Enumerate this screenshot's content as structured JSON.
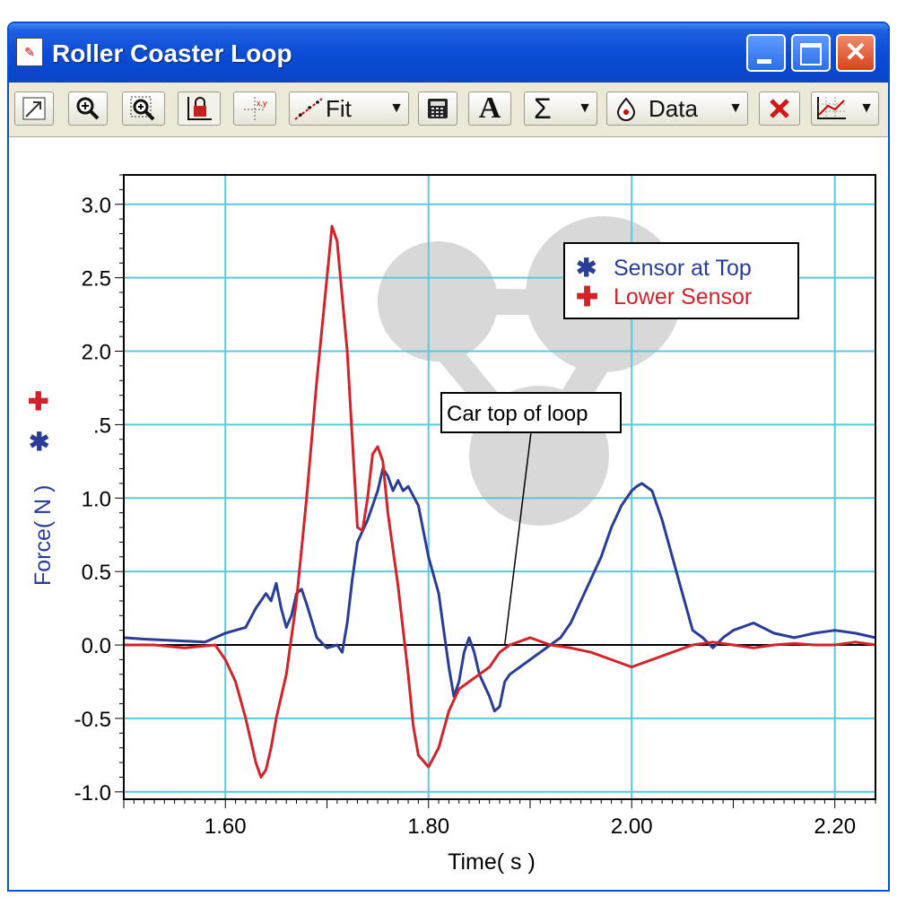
{
  "window": {
    "title": "Roller Coaster Loop",
    "controls": {
      "minimize_icon": "minimize-icon",
      "maximize_icon": "maximize-icon",
      "close_symbol": "✕"
    }
  },
  "toolbar": {
    "buttons": [
      {
        "name": "autoscale-icon"
      },
      {
        "name": "zoom-in-icon"
      },
      {
        "name": "zoom-region-icon"
      },
      {
        "name": "lock-axes-icon"
      },
      {
        "name": "examine-icon"
      },
      {
        "name": "fit",
        "label": "Fit",
        "dropdown": true
      },
      {
        "name": "calculator-icon"
      },
      {
        "name": "annotate",
        "label": "A"
      },
      {
        "name": "statistics",
        "label": "Σ",
        "dropdown": true
      },
      {
        "name": "data",
        "label": "Data",
        "dropdown": true
      },
      {
        "name": "delete-icon"
      },
      {
        "name": "graph-options-icon",
        "dropdown": true
      }
    ]
  },
  "chart_data": {
    "type": "line",
    "xlabel": "Time( s )",
    "ylabel": "Force( N )",
    "xlim": [
      1.5,
      2.24
    ],
    "ylim": [
      -1.05,
      3.2
    ],
    "x_ticks": [
      1.6,
      1.8,
      2.0,
      2.2
    ],
    "x_tick_labels": [
      "1.60",
      "1.80",
      "2.00",
      "2.20"
    ],
    "y_ticks": [
      3.0,
      2.5,
      2.0,
      1.5,
      1.0,
      0.5,
      0.0,
      -0.5,
      -1.0
    ],
    "y_tick_labels": [
      "3.0",
      "2.5",
      "2.0",
      ".5",
      "1.0",
      "0.5",
      "0.0",
      "-0.5",
      "-1.0"
    ],
    "grid": true,
    "legend_position": "top-right",
    "annotation": {
      "text": "Car top of loop",
      "x": 1.875,
      "y": 0.0
    },
    "series": [
      {
        "name": "Sensor at Top",
        "color": "#2a3d96",
        "marker": "asterisk",
        "points": [
          [
            1.5,
            0.05
          ],
          [
            1.52,
            0.04
          ],
          [
            1.55,
            0.03
          ],
          [
            1.58,
            0.02
          ],
          [
            1.6,
            0.08
          ],
          [
            1.62,
            0.12
          ],
          [
            1.63,
            0.25
          ],
          [
            1.64,
            0.35
          ],
          [
            1.645,
            0.3
          ],
          [
            1.65,
            0.42
          ],
          [
            1.655,
            0.25
          ],
          [
            1.66,
            0.12
          ],
          [
            1.665,
            0.2
          ],
          [
            1.67,
            0.35
          ],
          [
            1.675,
            0.38
          ],
          [
            1.68,
            0.28
          ],
          [
            1.69,
            0.05
          ],
          [
            1.7,
            -0.02
          ],
          [
            1.71,
            0.0
          ],
          [
            1.715,
            -0.05
          ],
          [
            1.72,
            0.15
          ],
          [
            1.725,
            0.45
          ],
          [
            1.73,
            0.7
          ],
          [
            1.74,
            0.85
          ],
          [
            1.75,
            1.05
          ],
          [
            1.755,
            1.2
          ],
          [
            1.76,
            1.15
          ],
          [
            1.765,
            1.05
          ],
          [
            1.77,
            1.12
          ],
          [
            1.775,
            1.05
          ],
          [
            1.78,
            1.08
          ],
          [
            1.79,
            0.95
          ],
          [
            1.8,
            0.6
          ],
          [
            1.81,
            0.35
          ],
          [
            1.815,
            0.1
          ],
          [
            1.82,
            -0.15
          ],
          [
            1.825,
            -0.35
          ],
          [
            1.83,
            -0.25
          ],
          [
            1.835,
            -0.05
          ],
          [
            1.84,
            0.05
          ],
          [
            1.845,
            -0.05
          ],
          [
            1.85,
            -0.2
          ],
          [
            1.86,
            -0.35
          ],
          [
            1.865,
            -0.45
          ],
          [
            1.87,
            -0.42
          ],
          [
            1.875,
            -0.25
          ],
          [
            1.88,
            -0.2
          ],
          [
            1.89,
            -0.15
          ],
          [
            1.9,
            -0.1
          ],
          [
            1.91,
            -0.05
          ],
          [
            1.92,
            0.0
          ],
          [
            1.93,
            0.05
          ],
          [
            1.94,
            0.15
          ],
          [
            1.95,
            0.3
          ],
          [
            1.96,
            0.45
          ],
          [
            1.97,
            0.6
          ],
          [
            1.98,
            0.8
          ],
          [
            1.99,
            0.95
          ],
          [
            2.0,
            1.05
          ],
          [
            2.005,
            1.08
          ],
          [
            2.01,
            1.1
          ],
          [
            2.02,
            1.05
          ],
          [
            2.03,
            0.85
          ],
          [
            2.04,
            0.6
          ],
          [
            2.05,
            0.35
          ],
          [
            2.06,
            0.1
          ],
          [
            2.07,
            0.05
          ],
          [
            2.08,
            -0.02
          ],
          [
            2.09,
            0.05
          ],
          [
            2.1,
            0.1
          ],
          [
            2.12,
            0.15
          ],
          [
            2.14,
            0.08
          ],
          [
            2.16,
            0.05
          ],
          [
            2.18,
            0.08
          ],
          [
            2.2,
            0.1
          ],
          [
            2.22,
            0.08
          ],
          [
            2.24,
            0.05
          ]
        ]
      },
      {
        "name": "Lower Sensor",
        "color": "#d4222a",
        "marker": "plus",
        "points": [
          [
            1.5,
            0.0
          ],
          [
            1.53,
            0.0
          ],
          [
            1.56,
            -0.02
          ],
          [
            1.59,
            0.0
          ],
          [
            1.6,
            -0.1
          ],
          [
            1.61,
            -0.25
          ],
          [
            1.62,
            -0.5
          ],
          [
            1.63,
            -0.8
          ],
          [
            1.635,
            -0.9
          ],
          [
            1.64,
            -0.85
          ],
          [
            1.645,
            -0.7
          ],
          [
            1.65,
            -0.5
          ],
          [
            1.66,
            -0.2
          ],
          [
            1.67,
            0.3
          ],
          [
            1.68,
            1.0
          ],
          [
            1.69,
            1.8
          ],
          [
            1.7,
            2.5
          ],
          [
            1.705,
            2.85
          ],
          [
            1.71,
            2.75
          ],
          [
            1.72,
            2.0
          ],
          [
            1.725,
            1.4
          ],
          [
            1.73,
            0.8
          ],
          [
            1.735,
            0.78
          ],
          [
            1.74,
            1.0
          ],
          [
            1.745,
            1.3
          ],
          [
            1.75,
            1.35
          ],
          [
            1.755,
            1.25
          ],
          [
            1.76,
            0.9
          ],
          [
            1.77,
            0.4
          ],
          [
            1.78,
            -0.2
          ],
          [
            1.785,
            -0.55
          ],
          [
            1.79,
            -0.75
          ],
          [
            1.8,
            -0.83
          ],
          [
            1.81,
            -0.7
          ],
          [
            1.82,
            -0.45
          ],
          [
            1.83,
            -0.3
          ],
          [
            1.84,
            -0.25
          ],
          [
            1.85,
            -0.2
          ],
          [
            1.86,
            -0.15
          ],
          [
            1.87,
            -0.05
          ],
          [
            1.88,
            0.0
          ],
          [
            1.9,
            0.05
          ],
          [
            1.92,
            0.0
          ],
          [
            1.94,
            -0.02
          ],
          [
            1.96,
            -0.05
          ],
          [
            1.98,
            -0.1
          ],
          [
            2.0,
            -0.15
          ],
          [
            2.02,
            -0.1
          ],
          [
            2.04,
            -0.05
          ],
          [
            2.06,
            0.0
          ],
          [
            2.08,
            0.02
          ],
          [
            2.1,
            0.0
          ],
          [
            2.12,
            -0.02
          ],
          [
            2.14,
            0.0
          ],
          [
            2.16,
            0.01
          ],
          [
            2.18,
            0.0
          ],
          [
            2.2,
            0.0
          ],
          [
            2.22,
            0.02
          ],
          [
            2.24,
            0.0
          ]
        ]
      }
    ]
  }
}
